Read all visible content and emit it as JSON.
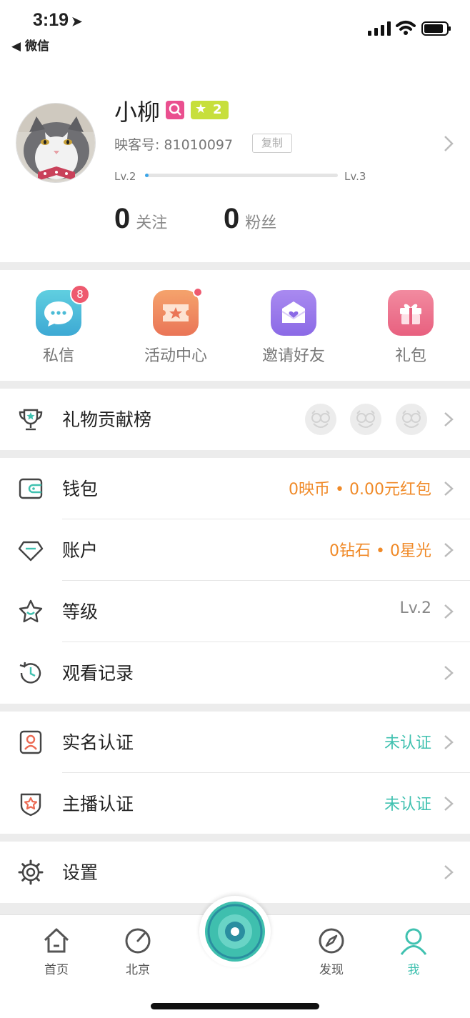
{
  "status_bar": {
    "time": "3:19",
    "back_label": "◀ 微信"
  },
  "profile": {
    "name": "小柳",
    "level_badge": "2",
    "id_label": "映客号:",
    "id_value": "81010097",
    "copy_label": "复制",
    "level_from": "Lv.2",
    "level_to": "Lv.3",
    "level_progress": 0.01,
    "following_count": "0",
    "following_label": "关注",
    "fans_count": "0",
    "fans_label": "粉丝"
  },
  "quick_actions": [
    {
      "label": "私信",
      "badge": "8",
      "icon": "chat-bubble-icon",
      "color": "#4bbbd6"
    },
    {
      "label": "活动中心",
      "icon": "ticket-icon",
      "color": "#f08c5e"
    },
    {
      "label": "邀请好友",
      "icon": "envelope-heart-icon",
      "color": "#9477ea"
    },
    {
      "label": "礼包",
      "icon": "gift-box-icon",
      "color": "#ec6f8b"
    }
  ],
  "gift_rank": {
    "label": "礼物贡献榜",
    "icon": "trophy-icon"
  },
  "menu": {
    "wallet": {
      "label": "钱包",
      "value": "0映币 • 0.00元红包",
      "icon": "wallet-icon"
    },
    "account": {
      "label": "账户",
      "value": "0钻石 • 0星光",
      "icon": "diamond-icon"
    },
    "level": {
      "label": "等级",
      "value": "Lv.2",
      "icon": "star-icon"
    },
    "history": {
      "label": "观看记录",
      "icon": "history-clock-icon"
    },
    "real_name": {
      "label": "实名认证",
      "value": "未认证",
      "icon": "id-card-icon"
    },
    "host_cert": {
      "label": "主播认证",
      "value": "未认证",
      "icon": "shield-star-icon"
    },
    "settings": {
      "label": "设置",
      "icon": "gear-icon"
    }
  },
  "tabs": [
    {
      "label": "首页",
      "icon": "home-icon"
    },
    {
      "label": "北京",
      "icon": "compass-dial-icon"
    },
    {
      "label": "发现",
      "icon": "discover-compass-icon"
    },
    {
      "label": "我",
      "icon": "user-icon",
      "active": true
    }
  ],
  "colors": {
    "accent": "#40c1b0",
    "orange": "#f08a28",
    "badge_red": "#ee5a6f"
  }
}
